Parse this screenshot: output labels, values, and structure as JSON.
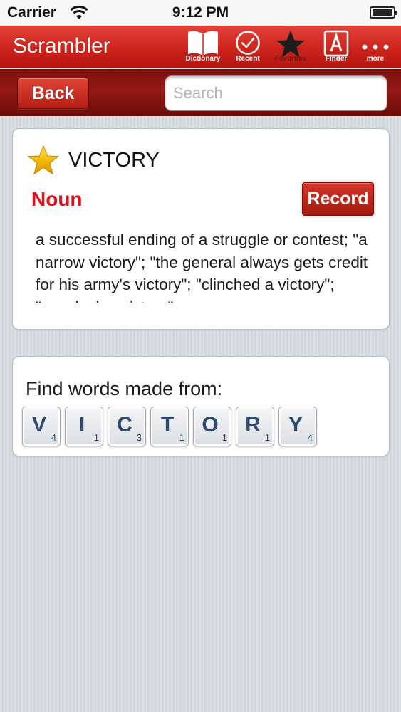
{
  "status_bar": {
    "carrier": "Carrier",
    "time": "9:12 PM"
  },
  "nav": {
    "title": "Scrambler",
    "items": [
      {
        "label": "Dictionary",
        "icon": "book-icon"
      },
      {
        "label": "Recent",
        "icon": "check-circle-icon"
      },
      {
        "label": "Favorites",
        "icon": "star-icon"
      },
      {
        "label": "Finder",
        "icon": "letter-a-icon"
      },
      {
        "label": "more",
        "icon": "more-dots-icon"
      }
    ]
  },
  "toolbar": {
    "back_label": "Back",
    "search_placeholder": "Search",
    "search_value": ""
  },
  "entry": {
    "word": "VICTORY",
    "favorite": true,
    "part_of_speech": "Noun",
    "record_label": "Record",
    "definition": "a successful ending of a struggle or contest; \"a narrow victory\"; \"the general always gets credit for his army's victory\"; \"clinched a victory\"; \"convincing victory\""
  },
  "scrambler": {
    "label": "Find words made from:",
    "tiles": [
      {
        "letter": "V",
        "score": "4"
      },
      {
        "letter": "I",
        "score": "1"
      },
      {
        "letter": "C",
        "score": "3"
      },
      {
        "letter": "T",
        "score": "1"
      },
      {
        "letter": "O",
        "score": "1"
      },
      {
        "letter": "R",
        "score": "1"
      },
      {
        "letter": "Y",
        "score": "4"
      }
    ]
  },
  "colors": {
    "nav_red": "#d0261e",
    "toolbar_dark_red": "#941914",
    "part_of_speech_red": "#e0111a",
    "tile_letter_blue": "#2d4a73",
    "star_gold": "#f2b705"
  }
}
